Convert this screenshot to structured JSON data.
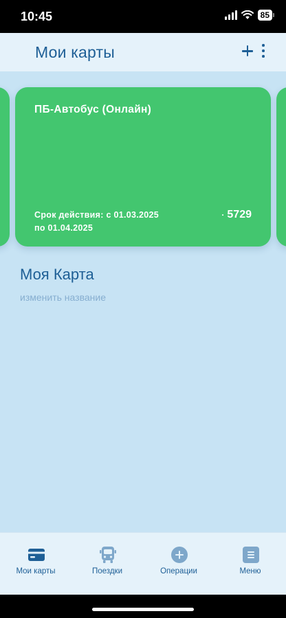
{
  "status_bar": {
    "time": "10:45",
    "battery": "85",
    "icons": [
      "signal-icon",
      "wifi-icon",
      "battery-icon"
    ]
  },
  "header": {
    "title": "Мои карты",
    "icons": [
      "plus-icon",
      "more-vertical-icon"
    ]
  },
  "card": {
    "title": "ПБ-Автобус (Онлайн)",
    "validity_line1": "Срок действия: с 01.03.2025",
    "validity_line2": "по 01.04.2025",
    "number_prefix": "·",
    "number": "5729",
    "color": "#43c66f"
  },
  "card_name": {
    "title": "Моя Карта",
    "rename_label": "изменить название"
  },
  "bottom_nav": {
    "items": [
      {
        "label": "Мои карты",
        "icon": "credit-card-icon"
      },
      {
        "label": "Поездки",
        "icon": "bus-icon"
      },
      {
        "label": "Операции",
        "icon": "plus-circle-icon"
      },
      {
        "label": "Меню",
        "icon": "menu-icon"
      }
    ]
  },
  "colors": {
    "accent": "#1e5f96",
    "background": "#c7e3f4",
    "header_bg": "#e5f2fa",
    "muted_link": "#86aed0"
  }
}
